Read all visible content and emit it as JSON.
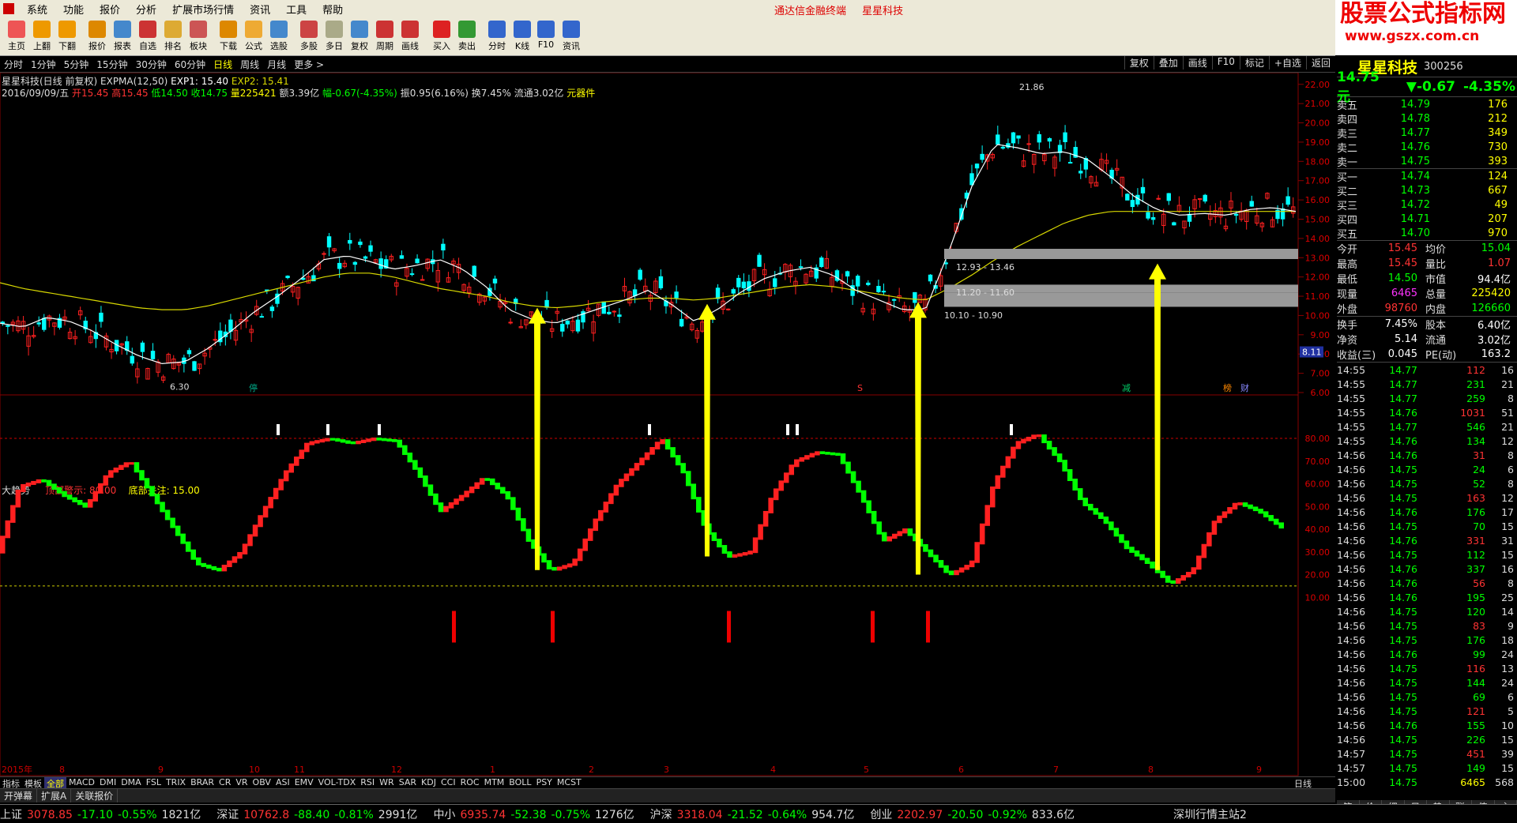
{
  "menu": {
    "items": [
      "系统",
      "功能",
      "报价",
      "分析",
      "扩展市场行情",
      "资讯",
      "工具",
      "帮助"
    ],
    "center_title": "通达信金融终端",
    "center_stock": "星星科技"
  },
  "logo": {
    "line1": "股票公式指标网",
    "line2": "www.gszx.com.cn"
  },
  "toolbar": {
    "items": [
      "主页",
      "上翻",
      "下翻",
      "报价",
      "报表",
      "自选",
      "排名",
      "板块",
      "下载",
      "公式",
      "选股",
      "多股",
      "多日",
      "复权",
      "周期",
      "画线",
      "买入",
      "卖出",
      "分时",
      "K线",
      "F10",
      "资讯"
    ]
  },
  "periods": {
    "items": [
      "分时",
      "1分钟",
      "5分钟",
      "15分钟",
      "30分钟",
      "60分钟",
      "日线",
      "周线",
      "月线",
      "更多 >"
    ],
    "active": "日线",
    "right_tools": [
      "复权",
      "叠加",
      "画线",
      "F10",
      "标记",
      "+自选",
      "返回"
    ]
  },
  "main_chart": {
    "title": "星星科技(日线 前复权)",
    "expma": "EXPMA(12,50)",
    "exp1": "EXP1: 15.40",
    "exp2": "EXP2: 15.41",
    "date": "2016/09/09/五",
    "open": "开15.45",
    "high": "高15.45",
    "low": "低14.50",
    "close": "收14.75",
    "vol": "量225421",
    "amt": "额3.39亿",
    "chg": "幅-0.67(-4.35%)",
    "amp": "振0.95(6.16%)",
    "turn": "换7.45%",
    "float": "流通3.02亿",
    "sector": "元器件",
    "high_label": "21.86",
    "low_label": "6.30",
    "zones": [
      "12.93 - 13.46",
      "11.20 - 11.60",
      "10.10 - 10.90"
    ],
    "price_marker": "8.11",
    "y_ticks": [
      "22.00",
      "21.00",
      "20.00",
      "19.00",
      "18.00",
      "17.00",
      "16.00",
      "15.00",
      "14.00",
      "13.00",
      "12.00",
      "11.00",
      "10.00",
      "9.00",
      "8.00",
      "7.00",
      "6.00"
    ],
    "markers": [
      "停",
      "S",
      "减",
      "榜",
      "财"
    ]
  },
  "indicator": {
    "name": "大趋势",
    "top_label": "顶部警示: 80.00",
    "bottom_label": "底部关注: 15.00",
    "y_ticks": [
      "80.00",
      "70.00",
      "60.00",
      "50.00",
      "40.00",
      "30.00",
      "20.00",
      "10.00"
    ]
  },
  "chart_data": {
    "type": "line",
    "series": [
      {
        "name": "EXP1",
        "values": [
          9.6,
          9.4,
          9.9,
          9.7,
          9.2,
          8.5,
          7.9,
          7.5,
          7.6,
          8.3,
          9.2,
          10.2,
          11.0,
          11.9,
          12.9,
          13.1,
          12.8,
          12.4,
          12.6,
          12.9,
          12.4,
          11.5,
          10.3,
          9.8,
          9.6,
          10.0,
          10.4,
          10.8,
          11.3,
          10.6,
          9.7,
          10.3,
          11.2,
          11.9,
          12.3,
          12.5,
          12.1,
          11.3,
          10.8,
          10.3,
          10.3,
          13.3,
          16.7,
          18.9,
          18.7,
          18.4,
          18.5,
          18.1,
          17.2,
          16.2,
          15.5,
          15.2,
          15.3,
          15.2,
          15.5,
          15.6,
          15.4
        ]
      },
      {
        "name": "EXP2",
        "values": [
          11.7,
          11.4,
          11.2,
          11.0,
          10.8,
          10.6,
          10.4,
          10.3,
          10.3,
          10.5,
          10.8,
          11.1,
          11.4,
          11.7,
          12.0,
          12.2,
          12.2,
          12.0,
          11.7,
          11.4,
          11.2,
          11.0,
          10.7,
          10.5,
          10.4,
          10.5,
          10.7,
          10.8,
          10.9,
          10.9,
          10.8,
          10.9,
          11.1,
          11.3,
          11.5,
          11.6,
          11.5,
          11.3,
          11.1,
          10.9,
          10.8,
          11.4,
          12.1,
          12.9,
          13.6,
          14.2,
          14.8,
          15.2,
          15.4,
          15.4,
          15.4,
          15.4,
          15.4,
          15.4,
          15.4,
          15.4,
          15.4
        ]
      },
      {
        "name": "大趋势",
        "values": [
          30,
          59,
          62,
          55,
          50,
          65,
          70,
          55,
          40,
          25,
          22,
          30,
          48,
          65,
          78,
          80,
          78,
          80,
          79,
          65,
          48,
          55,
          63,
          55,
          35,
          22,
          25,
          44,
          60,
          70,
          80,
          65,
          40,
          28,
          30,
          55,
          70,
          74,
          73,
          55,
          35,
          40,
          30,
          20,
          25,
          60,
          78,
          82,
          70,
          52,
          44,
          32,
          25,
          16,
          22,
          44,
          52,
          48,
          41
        ]
      }
    ],
    "top_alert": 80,
    "bottom_watch": 15,
    "ylim_price": [
      6,
      22.4
    ],
    "ylim_indicator": [
      0,
      88
    ]
  },
  "x_labels": [
    "2015年",
    "8",
    "9",
    "10",
    "11",
    "12",
    "1",
    "2",
    "3",
    "4",
    "5",
    "6",
    "7",
    "8",
    "9"
  ],
  "indicators_bar": {
    "items": [
      "指标",
      "模板",
      "全部",
      "MACD",
      "DMI",
      "DMA",
      "FSL",
      "TRIX",
      "BRAR",
      "CR",
      "VR",
      "OBV",
      "ASI",
      "EMV",
      "VOL-TDX",
      "RSI",
      "WR",
      "SAR",
      "KDJ",
      "CCI",
      "ROC",
      "MTM",
      "BOLL",
      "PSY",
      "MCST"
    ],
    "active": "全部",
    "right": "日线"
  },
  "bottom_tabs": {
    "items": [
      "开弹幕",
      "扩展A",
      "关联报价"
    ]
  },
  "quote": {
    "name": "星星科技",
    "code": "300256",
    "price": "14.75元",
    "chg": "▼-0.67",
    "pct": "-4.35%",
    "asks": [
      [
        "卖五",
        "14.79",
        "176"
      ],
      [
        "卖四",
        "14.78",
        "212"
      ],
      [
        "卖三",
        "14.77",
        "349"
      ],
      [
        "卖二",
        "14.76",
        "730"
      ],
      [
        "卖一",
        "14.75",
        "393"
      ]
    ],
    "bids": [
      [
        "买一",
        "14.74",
        "124"
      ],
      [
        "买二",
        "14.73",
        "667"
      ],
      [
        "买三",
        "14.72",
        "49"
      ],
      [
        "买四",
        "14.71",
        "207"
      ],
      [
        "买五",
        "14.70",
        "970"
      ]
    ],
    "stats": [
      [
        "今开",
        "15.45",
        "均价",
        "15.04"
      ],
      [
        "最高",
        "15.45",
        "量比",
        "1.07"
      ],
      [
        "最低",
        "14.50",
        "市值",
        "94.4亿"
      ],
      [
        "现量",
        "6465",
        "总量",
        "225420"
      ],
      [
        "外盘",
        "98760",
        "内盘",
        "126660"
      ]
    ],
    "stats2": [
      [
        "换手",
        "7.45%",
        "股本",
        "6.40亿"
      ],
      [
        "净资",
        "5.14",
        "流通",
        "3.02亿"
      ],
      [
        "收益(三)",
        "0.045",
        "PE(动)",
        "163.2"
      ]
    ],
    "ticks": [
      [
        "14:55",
        "14.77",
        "112",
        "16"
      ],
      [
        "14:55",
        "14.77",
        "231",
        "21"
      ],
      [
        "14:55",
        "14.77",
        "259",
        "8"
      ],
      [
        "14:55",
        "14.76",
        "1031",
        "51"
      ],
      [
        "14:55",
        "14.77",
        "546",
        "21"
      ],
      [
        "14:55",
        "14.76",
        "134",
        "12"
      ],
      [
        "14:56",
        "14.76",
        "31",
        "8"
      ],
      [
        "14:56",
        "14.75",
        "24",
        "6"
      ],
      [
        "14:56",
        "14.75",
        "52",
        "8"
      ],
      [
        "14:56",
        "14.75",
        "163",
        "12"
      ],
      [
        "14:56",
        "14.76",
        "176",
        "17"
      ],
      [
        "14:56",
        "14.75",
        "70",
        "15"
      ],
      [
        "14:56",
        "14.76",
        "331",
        "31"
      ],
      [
        "14:56",
        "14.75",
        "112",
        "15"
      ],
      [
        "14:56",
        "14.76",
        "337",
        "16"
      ],
      [
        "14:56",
        "14.76",
        "56",
        "8"
      ],
      [
        "14:56",
        "14.76",
        "195",
        "25"
      ],
      [
        "14:56",
        "14.75",
        "120",
        "14"
      ],
      [
        "14:56",
        "14.75",
        "83",
        "9"
      ],
      [
        "14:56",
        "14.75",
        "176",
        "18"
      ],
      [
        "14:56",
        "14.76",
        "99",
        "24"
      ],
      [
        "14:56",
        "14.75",
        "116",
        "13"
      ],
      [
        "14:56",
        "14.75",
        "144",
        "24"
      ],
      [
        "14:56",
        "14.75",
        "69",
        "6"
      ],
      [
        "14:56",
        "14.75",
        "121",
        "5"
      ],
      [
        "14:56",
        "14.76",
        "155",
        "10"
      ],
      [
        "14:56",
        "14.75",
        "226",
        "15"
      ],
      [
        "14:57",
        "14.75",
        "451",
        "39"
      ],
      [
        "14:57",
        "14.75",
        "149",
        "15"
      ],
      [
        "15:00",
        "14.75",
        "6465",
        "568"
      ]
    ],
    "tabs": [
      "笔",
      "价",
      "细",
      "日",
      "势",
      "联",
      "值",
      "主"
    ]
  },
  "status": {
    "items": [
      {
        "name": "上证",
        "val": "3078.85",
        "chg": "-17.10",
        "pct": "-0.55%",
        "amt": "1821亿"
      },
      {
        "name": "深证",
        "val": "10762.8",
        "chg": "-88.40",
        "pct": "-0.81%",
        "amt": "2991亿"
      },
      {
        "name": "中小",
        "val": "6935.74",
        "chg": "-52.38",
        "pct": "-0.75%",
        "amt": "1276亿"
      },
      {
        "name": "沪深",
        "val": "3318.04",
        "chg": "-21.52",
        "pct": "-0.64%",
        "amt": "954.7亿"
      },
      {
        "name": "创业",
        "val": "2202.97",
        "chg": "-20.50",
        "pct": "-0.92%",
        "amt": "833.6亿"
      }
    ],
    "server": "深圳行情主站2"
  },
  "colors": {
    "up": "#ff2020",
    "down": "#00ffff",
    "exp1": "#ffffff",
    "exp2": "#d8d800",
    "arrow": "#ffff00",
    "ind_up": "#ff2020",
    "ind_down": "#00ff00"
  }
}
